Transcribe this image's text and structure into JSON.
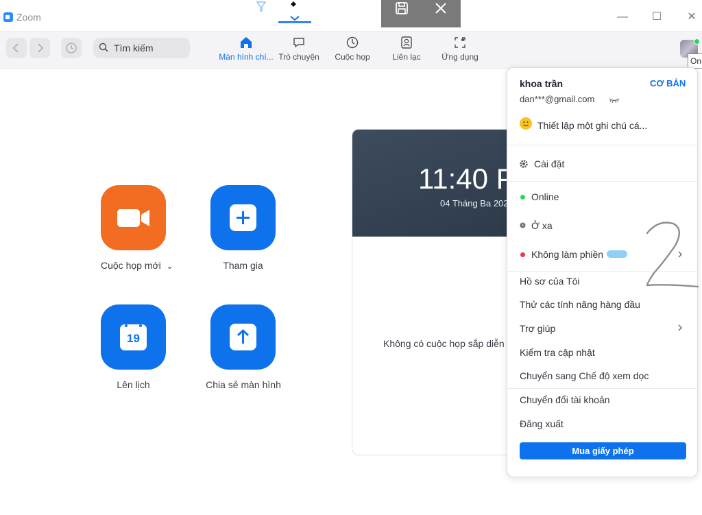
{
  "window": {
    "title": "Zoom",
    "minimize_glyph": "—",
    "maximize_glyph": "☐",
    "close_glyph": "✕"
  },
  "toolbar": {
    "back_icon": "chevron-left-icon",
    "forward_icon": "chevron-right-icon",
    "history_icon": "history-icon",
    "search_placeholder": "Tìm kiếm",
    "tabs": [
      {
        "label": "Màn hình chí...",
        "icon": "home-icon",
        "active": true
      },
      {
        "label": "Trò chuyện",
        "icon": "chat-icon",
        "active": false
      },
      {
        "label": "Cuộc họp",
        "icon": "clock-icon",
        "active": false
      },
      {
        "label": "Liên lạc",
        "icon": "contacts-icon",
        "active": false
      },
      {
        "label": "Ứng dụng",
        "icon": "apps-icon",
        "active": false
      }
    ],
    "avatar_tooltip": "On"
  },
  "actions": [
    {
      "label": "Cuộc họp mới",
      "icon": "video-camera-icon",
      "color": "#f26d21"
    },
    {
      "label": "Tham gia",
      "icon": "plus-icon",
      "color": "#0e72ed"
    },
    {
      "label": "Lên lịch",
      "icon": "calendar-icon",
      "color": "#0e72ed",
      "calendar_day": "19"
    },
    {
      "label": "Chia sẻ màn hình",
      "icon": "share-screen-arrow-icon",
      "color": "#0e72ed"
    }
  ],
  "new_meeting_caret": "⌄",
  "card": {
    "time": "11:40 P",
    "date": "04 Tháng Ba 202",
    "empty_text": "Không có cuộc họp sắp diễn ra"
  },
  "menu": {
    "user_name": "khoa trần",
    "plan": "CƠ BẢN",
    "email": "dan***@gmail.com",
    "email_toggle_icon": "eye-closed-icon",
    "note_placeholder": "Thiết lập một ghi chú cá...",
    "settings": "Cài đặt",
    "status_online": "Online",
    "status_away": "Ở xa",
    "status_dnd": "Không làm phiền",
    "my_profile": "Hồ sơ của Tôi",
    "try_features": "Thử các tính năng hàng đầu",
    "help": "Trợ giúp",
    "check_updates": "Kiểm tra cập nhật",
    "portrait_mode": "Chuyển sang Chế độ xem dọc",
    "switch_account": "Chuyển đổi tài khoản",
    "sign_out": "Đăng xuất",
    "buy_license": "Mua giấy phép"
  },
  "colors": {
    "accent": "#0e72ed",
    "orange": "#f26d21",
    "online": "#23d959",
    "away": "#6e6e78",
    "dnd": "#e8384f"
  }
}
